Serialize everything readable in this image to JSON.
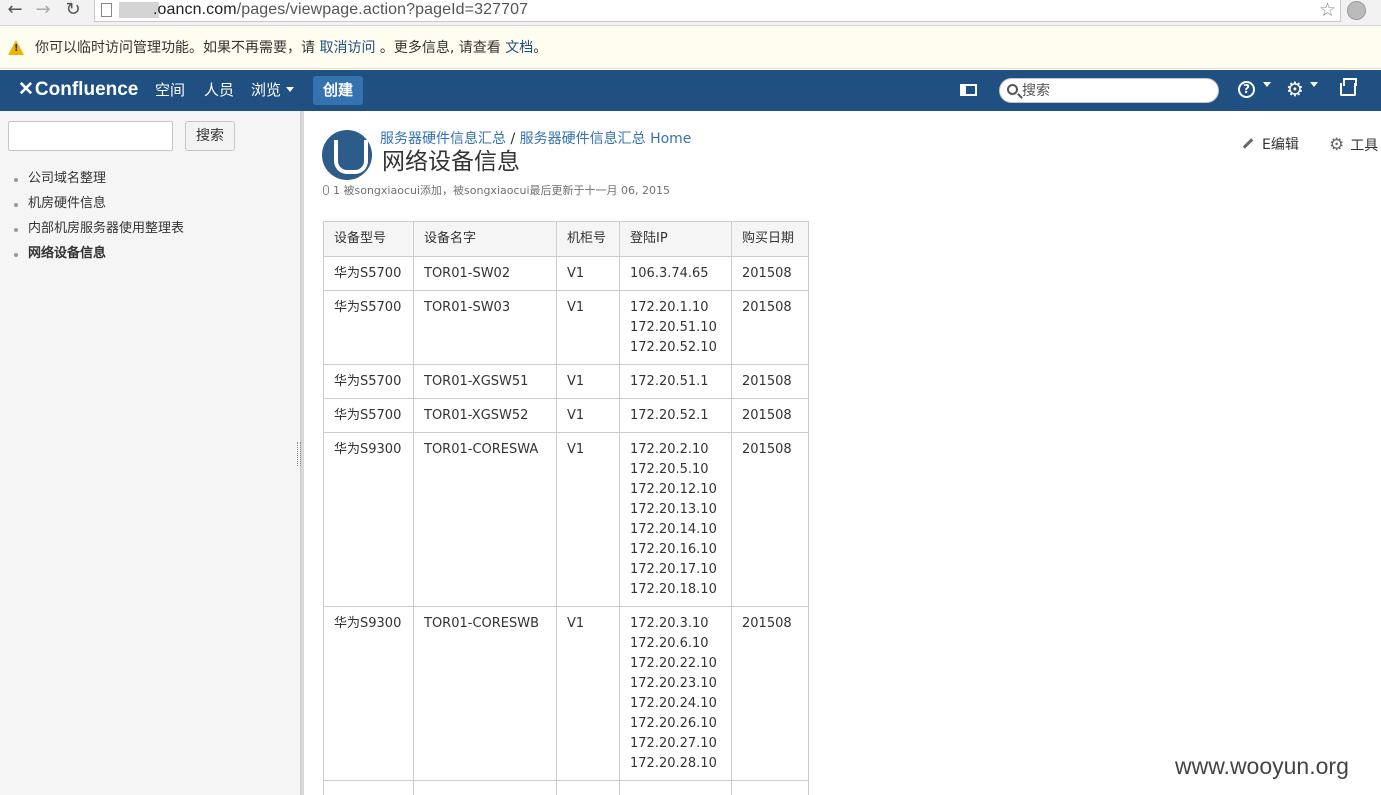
{
  "browser": {
    "url_host": ".oancn.com",
    "url_path": "/pages/viewpage.action?pageId=327707"
  },
  "notice": {
    "text_before": "你可以临时访问管理功能。如果不再需要，请 ",
    "link_cancel": "取消访问",
    "text_middle": " 。更多信息, 请查看 ",
    "link_docs": "文档",
    "text_end": "。"
  },
  "header": {
    "logo": "Confluence",
    "nav": {
      "spaces": "空间",
      "people": "人员",
      "browse": "浏览"
    },
    "create_label": "创建",
    "search_placeholder": "搜索"
  },
  "sidebar": {
    "search_button": "搜索",
    "items": [
      {
        "label": "公司域名整理"
      },
      {
        "label": "机房硬件信息"
      },
      {
        "label": "内部机房服务器使用整理表"
      },
      {
        "label": "网络设备信息"
      }
    ]
  },
  "page": {
    "breadcrumb": {
      "space": "服务器硬件信息汇总",
      "separator": "/",
      "home": "服务器硬件信息汇总 Home"
    },
    "title": "网络设备信息",
    "edit_label": "E编辑",
    "tools_label": "工具",
    "meta": "1  被songxiaocui添加，被songxiaocui最后更新于十一月 06, 2015"
  },
  "table": {
    "headers": [
      "设备型号",
      "设备名字",
      "机柜号",
      "登陆IP",
      "购买日期"
    ],
    "rows": [
      {
        "model": "华为S5700",
        "name": "TOR01-SW02",
        "rack": "V1",
        "ips": [
          "106.3.74.65"
        ],
        "date": "201508"
      },
      {
        "model": "华为S5700",
        "name": "TOR01-SW03",
        "rack": "V1",
        "ips": [
          "172.20.1.10",
          "172.20.51.10",
          "172.20.52.10"
        ],
        "date": "201508"
      },
      {
        "model": "华为S5700",
        "name": "TOR01-XGSW51",
        "rack": "V1",
        "ips": [
          "172.20.51.1"
        ],
        "date": "201508"
      },
      {
        "model": "华为S5700",
        "name": "TOR01-XGSW52",
        "rack": "V1",
        "ips": [
          "172.20.52.1"
        ],
        "date": "201508"
      },
      {
        "model": "华为S9300",
        "name": "TOR01-CORESWA",
        "rack": "V1",
        "ips": [
          "172.20.2.10",
          "172.20.5.10",
          "172.20.12.10",
          "172.20.13.10",
          "172.20.14.10",
          "172.20.16.10",
          "172.20.17.10",
          "172.20.18.10"
        ],
        "date": "201508"
      },
      {
        "model": "华为S9300",
        "name": "TOR01-CORESWB",
        "rack": "V1",
        "ips": [
          "172.20.3.10",
          "172.20.6.10",
          "172.20.22.10",
          "172.20.23.10",
          "172.20.24.10",
          "172.20.26.10",
          "172.20.27.10",
          "172.20.28.10"
        ],
        "date": "201508"
      },
      {
        "model": "",
        "name": "",
        "rack": "",
        "ips": [],
        "date": ""
      }
    ]
  },
  "watermark": "www.wooyun.org"
}
